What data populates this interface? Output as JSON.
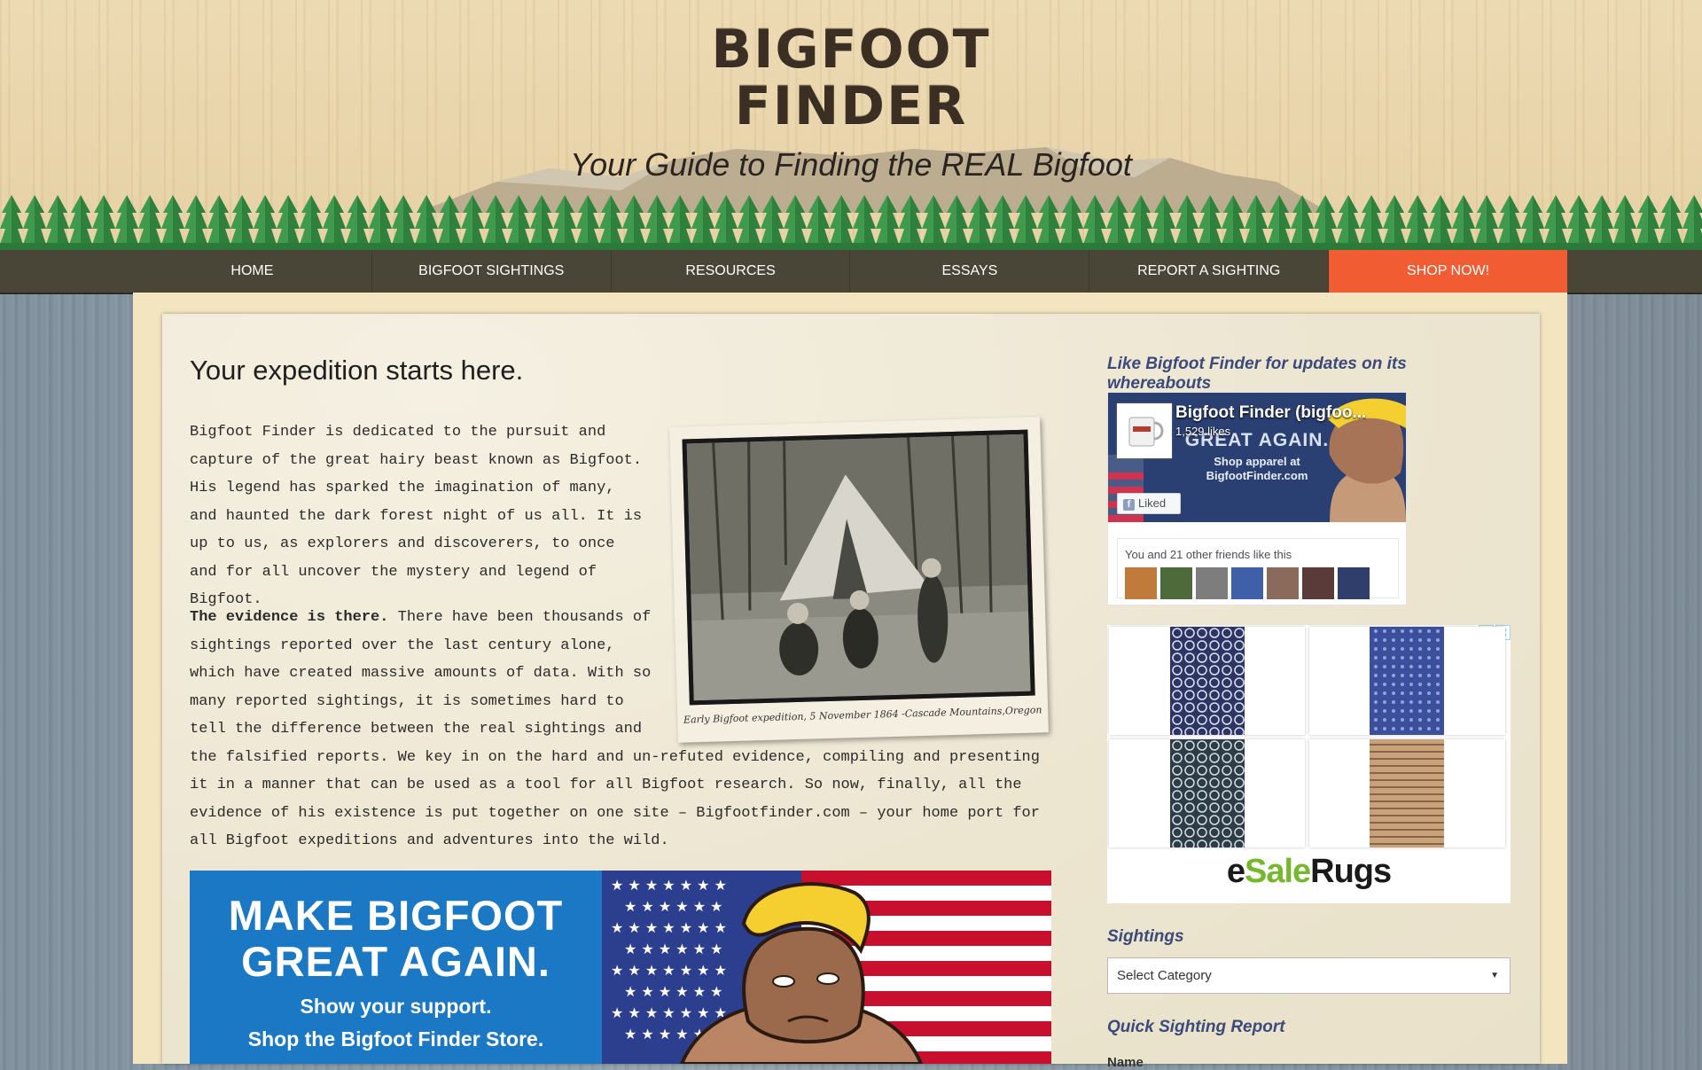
{
  "site": {
    "logo_line1": "BIGFOOT",
    "logo_line2": "FINDER",
    "tagline": "Your Guide to Finding the REAL Bigfoot"
  },
  "nav": {
    "items": [
      "HOME",
      "BIGFOOT SIGHTINGS",
      "RESOURCES",
      "ESSAYS",
      "REPORT A SIGHTING",
      "SHOP NOW!"
    ]
  },
  "main": {
    "heading": "Your expedition starts here.",
    "paragraph1": "Bigfoot Finder is dedicated to the pursuit and capture of the great hairy beast known as Bigfoot. His legend has sparked the imagination of many, and haunted the dark forest night of us all. It is up to us, as explorers and discoverers, to once and for all uncover the mystery and legend of Bigfoot.",
    "paragraph2_lead": "The evidence is there.",
    "paragraph2_body": " There have been thousands of sightings reported over the last century alone, which have created massive amounts of data. With so many reported sightings, it is sometimes hard to tell the difference between the real sightings and the falsified reports. We key in on the hard and un-refuted evidence, compiling and presenting it in a manner that can be used as a tool for all Bigfoot research. So now, finally, all the evidence of his existence is put together on one site – Bigfootfinder.com – your home port for all Bigfoot expeditions and adventures into the wild.",
    "photo_caption": "Early Bigfoot expedition, 5 November 1864 -Cascade Mountains,Oregon",
    "banner_line1": "MAKE BIGFOOT",
    "banner_line2": "GREAT AGAIN.",
    "banner_sub1": "Show your support.",
    "banner_sub2": "Shop the Bigfoot Finder Store."
  },
  "sidebar": {
    "fb_title": "Like Bigfoot Finder for updates on its whereabouts",
    "fb_page_name": "Bigfoot Finder (bigfoo...",
    "fb_likes": "1,529 likes",
    "fb_cover_line1": "GREAT AGAIN.",
    "fb_cover_line2": "Shop apparel at",
    "fb_cover_line3": "BigfootFinder.com",
    "fb_liked": "Liked",
    "fb_friends_text": "You and 21 other friends like this",
    "ad_brand_1": "e",
    "ad_brand_2": "Sale",
    "ad_brand_3": "Rugs",
    "sightings_title": "Sightings",
    "category_select": "Select Category",
    "quick_report_title": "Quick Sighting Report",
    "name_label": "Name"
  },
  "colors": {
    "nav_bg": "#494537",
    "shop_accent": "#f25c32",
    "widget_title": "#3b4a7a",
    "banner_blue": "#1b78c4",
    "esale_green": "#75b82c"
  }
}
